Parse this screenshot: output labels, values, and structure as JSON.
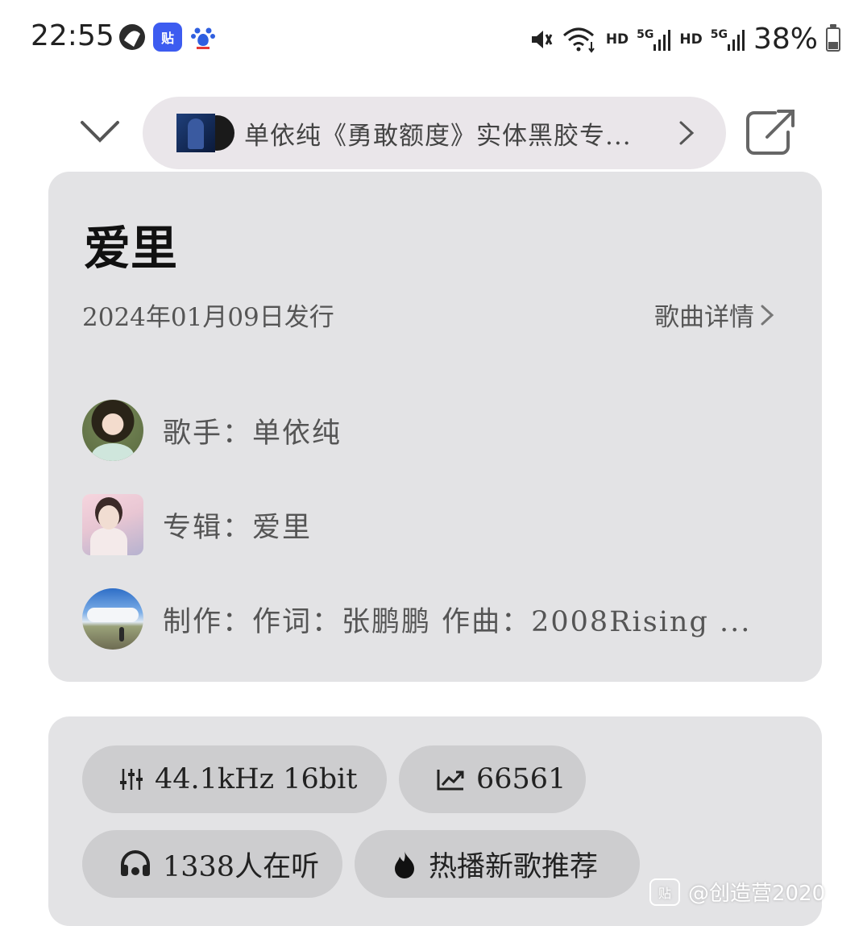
{
  "status_bar": {
    "time": "22:55",
    "app_icons": [
      "map-app-icon",
      "tieba-app-icon",
      "baidu-app-icon"
    ],
    "tieba_glyph": "贴",
    "baidu_glyph": "du",
    "hd1": "HD",
    "net1": "5G",
    "hd2": "HD",
    "net2": "5G",
    "battery": "38%",
    "battery_level": 0.38
  },
  "nav": {
    "album_pill_text": "单依纯《勇敢额度》实体黑胶专...",
    "collapse_icon": "chevron-down-icon",
    "share_icon": "share-icon"
  },
  "song": {
    "title": "爱里",
    "release": "2024年01月09日发行",
    "detail_link": "歌曲详情"
  },
  "credits": {
    "singer": "歌手：单依纯",
    "album": "专辑：爱里",
    "production": "制作：作词：张鹏鹏  作曲：2008Rising  ..."
  },
  "stats": {
    "quality": "44.1kHz   16bit",
    "plays": "66561",
    "listeners": "1338人在听",
    "tag": "热播新歌推荐"
  },
  "watermark": {
    "logo": "贴",
    "text": "@创造营2020"
  }
}
